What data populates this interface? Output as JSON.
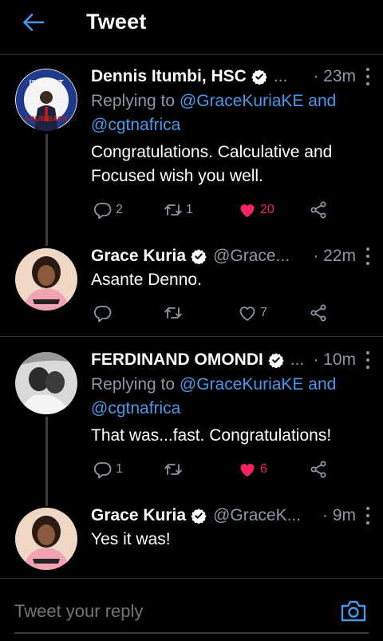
{
  "header": {
    "title": "Tweet"
  },
  "colors": {
    "accent": "#4a99e9",
    "like": "#f4245e",
    "muted": "#8b98a5",
    "background": "#000000"
  },
  "tweets": [
    {
      "name": "Dennis Itumbi, HSC",
      "handle": "...",
      "time": "· 23m",
      "replying_prefix": "Replying to",
      "replying_mentions": "@GraceKuriaKE and @cgtnafrica",
      "text": "Congratulations. Calculative and Focused  wish you well.",
      "avatar_text": "I'VE GOT YOUR BACK",
      "stats": {
        "replies": "2",
        "retweets": "1",
        "likes": "20",
        "liked": true
      }
    },
    {
      "name": "Grace Kuria",
      "handle": "@Grace...",
      "time": "· 22m",
      "text": "Asante Denno.",
      "stats": {
        "replies": "",
        "retweets": "",
        "likes": "7",
        "liked": false
      }
    },
    {
      "name": "FERDINAND OMONDI",
      "handle": "...",
      "time": "· 10m",
      "replying_prefix": "Replying to",
      "replying_mentions": "@GraceKuriaKE and @cgtnafrica",
      "text": "That was...fast. Congratulations!",
      "stats": {
        "replies": "1",
        "retweets": "",
        "likes": "6",
        "liked": true
      }
    },
    {
      "name": "Grace Kuria",
      "handle": "@GraceK...",
      "time": "· 9m",
      "text": "Yes it was!"
    }
  ],
  "reply": {
    "placeholder": "Tweet your reply"
  }
}
